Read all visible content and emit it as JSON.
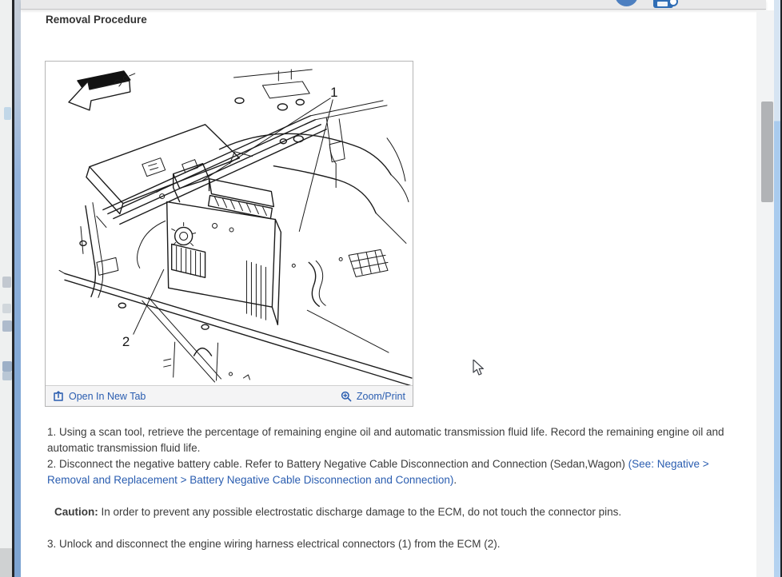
{
  "header": {
    "icons": {
      "avatar": "user-avatar-circle",
      "print": "printer"
    }
  },
  "content": {
    "heading": "Removal Procedure",
    "figure": {
      "actions": {
        "open_in_new_tab": "Open In New Tab",
        "zoom_print": "Zoom/Print"
      },
      "callouts": {
        "one": "1",
        "two": "2"
      },
      "icons": {
        "open_new_tab": "open-in-new-tab-box-arrow",
        "zoom": "magnifier-plus"
      }
    },
    "steps": {
      "step1": "1. Using a scan tool, retrieve the percentage of remaining engine oil and automatic transmission fluid life. Record the remaining engine oil and automatic transmission fluid life.",
      "step2_text": "2. Disconnect the negative battery cable. Refer to Battery Negative Cable Disconnection and Connection (Sedan,Wagon) ",
      "step2_link": "(See: Negative > Removal and Replacement > Battery Negative Cable Disconnection and Connection)",
      "step2_suffix": ".",
      "caution_label": "Caution:",
      "caution_text": "In order to prevent any possible electrostatic discharge damage to the ECM, do not touch the connector pins.",
      "step3": "3. Unlock and disconnect the engine wiring harness electrical connectors (1) from the ECM (2)."
    },
    "colors": {
      "link_blue": "#2a5db0",
      "icon_blue": "#2f6db5",
      "frame_blue": "#7fa7d6"
    }
  }
}
